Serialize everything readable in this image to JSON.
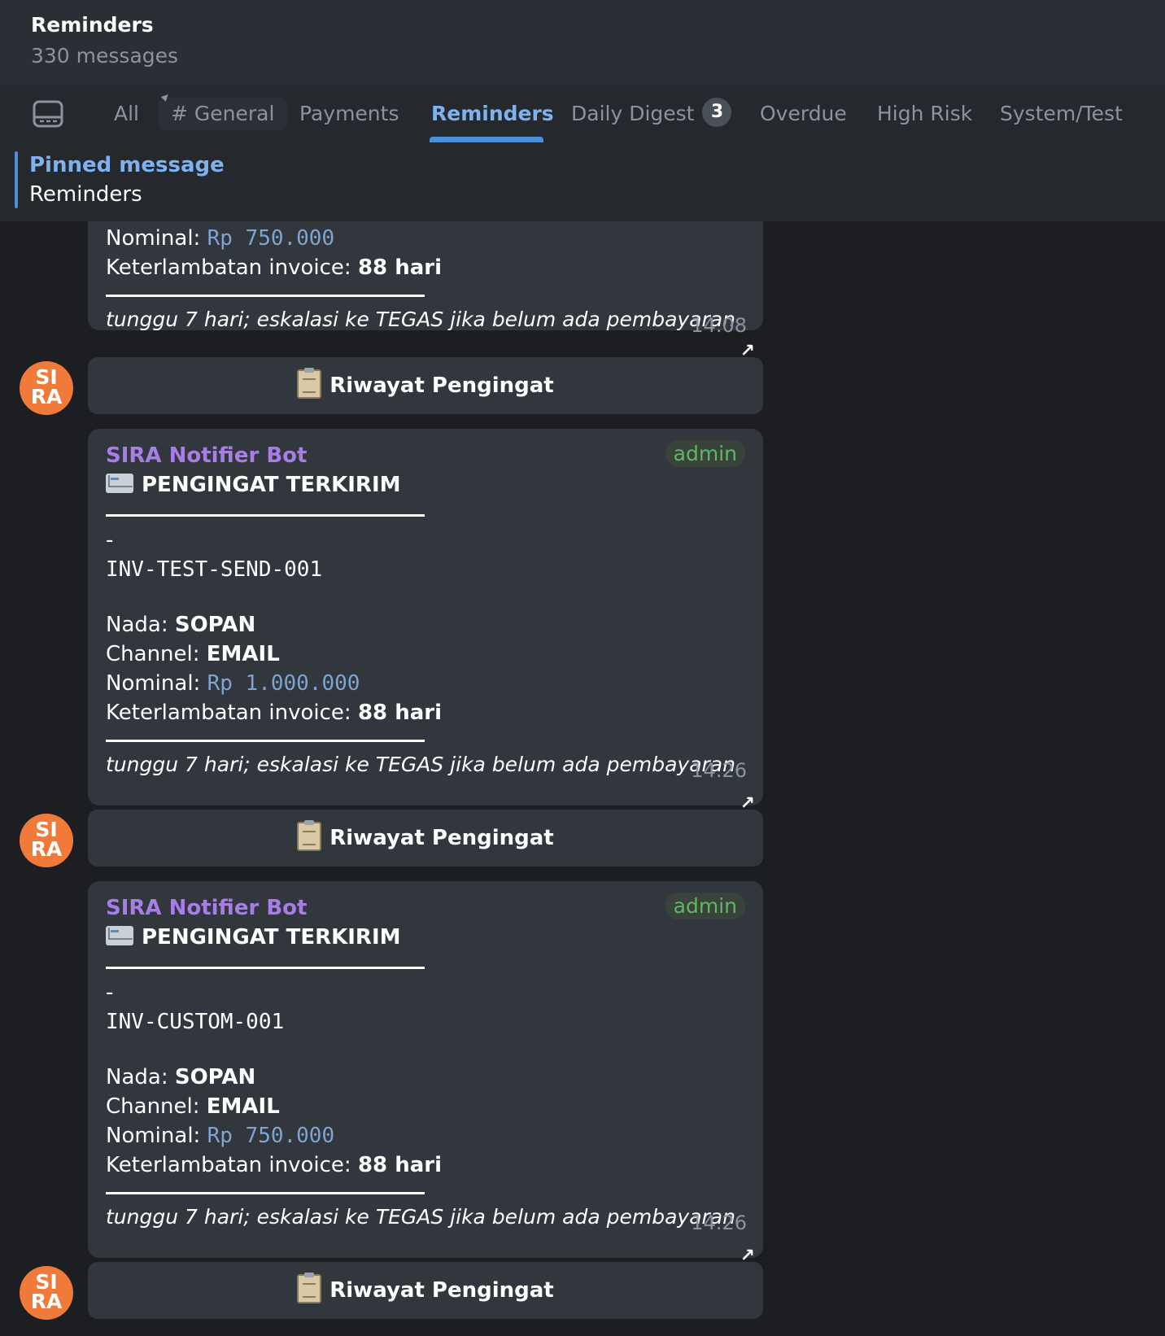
{
  "header": {
    "title": "Reminders",
    "subtitle": "330 messages"
  },
  "tabs": [
    {
      "label": "All"
    },
    {
      "label": "# General"
    },
    {
      "label": "Payments"
    },
    {
      "label": "Reminders",
      "active": true
    },
    {
      "label": "Daily Digest",
      "badge": "3"
    },
    {
      "label": "Overdue"
    },
    {
      "label": "High Risk"
    },
    {
      "label": "System/Test"
    }
  ],
  "pinned": {
    "label": "Pinned message",
    "text": "Reminders"
  },
  "messages": [
    {
      "nominal_label": "Nominal: ",
      "nominal_value": "Rp 750.000",
      "delay_label": "Keterlambatan invoice: ",
      "delay_value": "88 hari",
      "note": "tunggu 7 hari; eskalasi ke TEGAS jika belum ada pembayaran",
      "time": "14.08",
      "button": "Riwayat Pengingat"
    },
    {
      "sender": "SIRA Notifier Bot",
      "role": "admin",
      "heading": "PENGINGAT TERKIRIM",
      "dash": "-",
      "invoice": "INV-TEST-SEND-001",
      "tone_label": "Nada: ",
      "tone_value": "SOPAN",
      "channel_label": "Channel: ",
      "channel_value": "EMAIL",
      "nominal_label": "Nominal: ",
      "nominal_value": "Rp 1.000.000",
      "delay_label": "Keterlambatan invoice: ",
      "delay_value": "88 hari",
      "note": "tunggu 7 hari; eskalasi ke TEGAS jika belum ada pembayaran",
      "time": "14.26",
      "button": "Riwayat Pengingat"
    },
    {
      "sender": "SIRA Notifier Bot",
      "role": "admin",
      "heading": "PENGINGAT TERKIRIM",
      "dash": "-",
      "invoice": "INV-CUSTOM-001",
      "tone_label": "Nada: ",
      "tone_value": "SOPAN",
      "channel_label": "Channel: ",
      "channel_value": "EMAIL",
      "nominal_label": "Nominal: ",
      "nominal_value": "Rp 750.000",
      "delay_label": "Keterlambatan invoice: ",
      "delay_value": "88 hari",
      "note": "tunggu 7 hari; eskalasi ke TEGAS jika belum ada pembayaran",
      "time": "14.26",
      "button": "Riwayat Pengingat"
    }
  ],
  "avatar": {
    "line1": "SI",
    "line2": "RA",
    "color": "#f07a3a"
  },
  "colors": {
    "accent": "#4f8fd9",
    "sender": "#a67ee6",
    "admin": "#61b565",
    "mono": "#7ea4cf"
  }
}
